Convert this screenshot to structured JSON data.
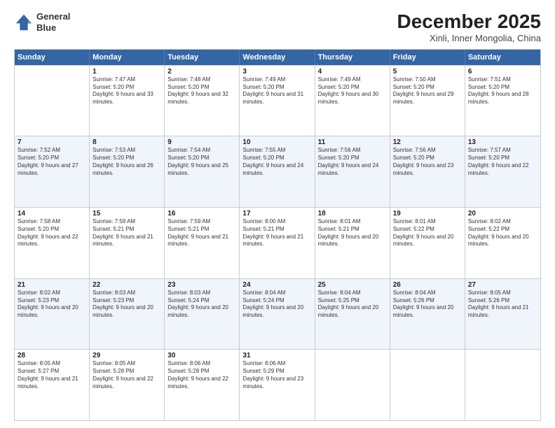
{
  "header": {
    "logo_line1": "General",
    "logo_line2": "Blue",
    "month": "December 2025",
    "location": "Xinli, Inner Mongolia, China"
  },
  "weekdays": [
    "Sunday",
    "Monday",
    "Tuesday",
    "Wednesday",
    "Thursday",
    "Friday",
    "Saturday"
  ],
  "rows": [
    {
      "cells": [
        {
          "empty": true
        },
        {
          "day": "1",
          "sunrise": "7:47 AM",
          "sunset": "5:20 PM",
          "daylight": "9 hours and 33 minutes."
        },
        {
          "day": "2",
          "sunrise": "7:48 AM",
          "sunset": "5:20 PM",
          "daylight": "9 hours and 32 minutes."
        },
        {
          "day": "3",
          "sunrise": "7:49 AM",
          "sunset": "5:20 PM",
          "daylight": "9 hours and 31 minutes."
        },
        {
          "day": "4",
          "sunrise": "7:49 AM",
          "sunset": "5:20 PM",
          "daylight": "9 hours and 30 minutes."
        },
        {
          "day": "5",
          "sunrise": "7:50 AM",
          "sunset": "5:20 PM",
          "daylight": "9 hours and 29 minutes."
        },
        {
          "day": "6",
          "sunrise": "7:51 AM",
          "sunset": "5:20 PM",
          "daylight": "9 hours and 28 minutes."
        }
      ]
    },
    {
      "cells": [
        {
          "day": "7",
          "sunrise": "7:52 AM",
          "sunset": "5:20 PM",
          "daylight": "9 hours and 27 minutes."
        },
        {
          "day": "8",
          "sunrise": "7:53 AM",
          "sunset": "5:20 PM",
          "daylight": "9 hours and 26 minutes."
        },
        {
          "day": "9",
          "sunrise": "7:54 AM",
          "sunset": "5:20 PM",
          "daylight": "9 hours and 25 minutes."
        },
        {
          "day": "10",
          "sunrise": "7:55 AM",
          "sunset": "5:20 PM",
          "daylight": "9 hours and 24 minutes."
        },
        {
          "day": "11",
          "sunrise": "7:56 AM",
          "sunset": "5:20 PM",
          "daylight": "9 hours and 24 minutes."
        },
        {
          "day": "12",
          "sunrise": "7:56 AM",
          "sunset": "5:20 PM",
          "daylight": "9 hours and 23 minutes."
        },
        {
          "day": "13",
          "sunrise": "7:57 AM",
          "sunset": "5:20 PM",
          "daylight": "9 hours and 22 minutes."
        }
      ]
    },
    {
      "cells": [
        {
          "day": "14",
          "sunrise": "7:58 AM",
          "sunset": "5:20 PM",
          "daylight": "9 hours and 22 minutes."
        },
        {
          "day": "15",
          "sunrise": "7:59 AM",
          "sunset": "5:21 PM",
          "daylight": "9 hours and 21 minutes."
        },
        {
          "day": "16",
          "sunrise": "7:59 AM",
          "sunset": "5:21 PM",
          "daylight": "9 hours and 21 minutes."
        },
        {
          "day": "17",
          "sunrise": "8:00 AM",
          "sunset": "5:21 PM",
          "daylight": "9 hours and 21 minutes."
        },
        {
          "day": "18",
          "sunrise": "8:01 AM",
          "sunset": "5:21 PM",
          "daylight": "9 hours and 20 minutes."
        },
        {
          "day": "19",
          "sunrise": "8:01 AM",
          "sunset": "5:22 PM",
          "daylight": "9 hours and 20 minutes."
        },
        {
          "day": "20",
          "sunrise": "8:02 AM",
          "sunset": "5:22 PM",
          "daylight": "9 hours and 20 minutes."
        }
      ]
    },
    {
      "cells": [
        {
          "day": "21",
          "sunrise": "8:02 AM",
          "sunset": "5:23 PM",
          "daylight": "9 hours and 20 minutes."
        },
        {
          "day": "22",
          "sunrise": "8:03 AM",
          "sunset": "5:23 PM",
          "daylight": "9 hours and 20 minutes."
        },
        {
          "day": "23",
          "sunrise": "8:03 AM",
          "sunset": "5:24 PM",
          "daylight": "9 hours and 20 minutes."
        },
        {
          "day": "24",
          "sunrise": "8:04 AM",
          "sunset": "5:24 PM",
          "daylight": "9 hours and 20 minutes."
        },
        {
          "day": "25",
          "sunrise": "8:04 AM",
          "sunset": "5:25 PM",
          "daylight": "9 hours and 20 minutes."
        },
        {
          "day": "26",
          "sunrise": "8:04 AM",
          "sunset": "5:26 PM",
          "daylight": "9 hours and 20 minutes."
        },
        {
          "day": "27",
          "sunrise": "8:05 AM",
          "sunset": "5:26 PM",
          "daylight": "9 hours and 21 minutes."
        }
      ]
    },
    {
      "cells": [
        {
          "day": "28",
          "sunrise": "8:05 AM",
          "sunset": "5:27 PM",
          "daylight": "9 hours and 21 minutes."
        },
        {
          "day": "29",
          "sunrise": "8:05 AM",
          "sunset": "5:28 PM",
          "daylight": "9 hours and 22 minutes."
        },
        {
          "day": "30",
          "sunrise": "8:06 AM",
          "sunset": "5:28 PM",
          "daylight": "9 hours and 22 minutes."
        },
        {
          "day": "31",
          "sunrise": "8:06 AM",
          "sunset": "5:29 PM",
          "daylight": "9 hours and 23 minutes."
        },
        {
          "empty": true
        },
        {
          "empty": true
        },
        {
          "empty": true
        }
      ]
    }
  ]
}
